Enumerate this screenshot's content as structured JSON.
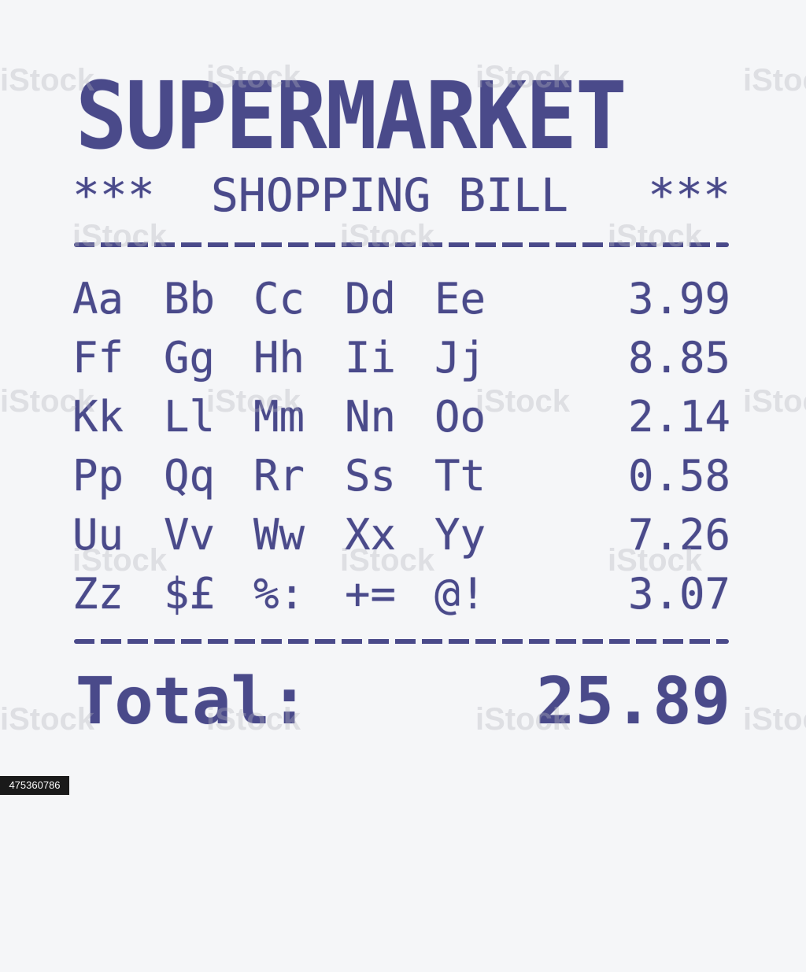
{
  "receipt": {
    "title": "SUPERMARKET",
    "subtitle_stars_left": "***",
    "subtitle": "SHOPPING BILL",
    "subtitle_stars_right": "***",
    "rows": [
      {
        "chars": [
          "Aa",
          "Bb",
          "Cc",
          "Dd",
          "Ee"
        ],
        "price": "3.99"
      },
      {
        "chars": [
          "Ff",
          "Gg",
          "Hh",
          "Ii",
          "Jj"
        ],
        "price": "8.85"
      },
      {
        "chars": [
          "Kk",
          "Ll",
          "Mm",
          "Nn",
          "Oo"
        ],
        "price": "2.14"
      },
      {
        "chars": [
          "Pp",
          "Qq",
          "Rr",
          "Ss",
          "Tt"
        ],
        "price": "0.58"
      },
      {
        "chars": [
          "Uu",
          "Vv",
          "Ww",
          "Xx",
          "Yy"
        ],
        "price": "7.26"
      },
      {
        "chars": [
          "Zz",
          "$£",
          "%:",
          "+=",
          "@!"
        ],
        "price": "3.07"
      }
    ],
    "total_label": "Total:",
    "total_value": "25.89"
  },
  "image_id": "475360786",
  "watermark": "iStock",
  "ink_color": "#4a4a8a",
  "background_color": "#f5f6f8"
}
